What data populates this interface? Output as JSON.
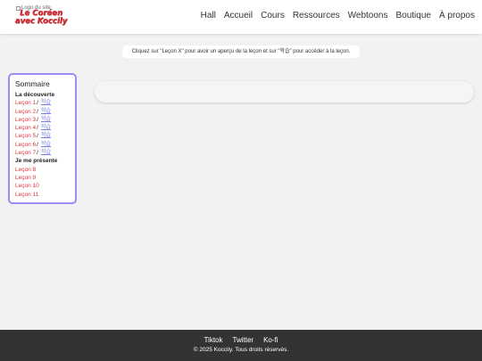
{
  "header": {
    "logo_alt": "Logo du site",
    "logo_text_line1": "Le Coréen",
    "logo_text_line2": "avec Koccily",
    "nav": [
      "Hall",
      "Accueil",
      "Cours",
      "Ressources",
      "Webtoons",
      "Boutique",
      "À propos"
    ]
  },
  "info_text": "Cliquez sur \"Leçon X\" pour avoir un aperçu de la leçon et sur \"학습\" pour accéder à la leçon.",
  "sommaire": {
    "title": "Sommaire",
    "sections": [
      {
        "title": "La découverte",
        "lessons": [
          {
            "label": "Leçon 1",
            "slash": "/",
            "hanja": "학습"
          },
          {
            "label": "Leçon 2",
            "slash": "/",
            "hanja": "학습"
          },
          {
            "label": "Leçon 3",
            "slash": "/",
            "hanja": "학습"
          },
          {
            "label": "Leçon 4",
            "slash": "/",
            "hanja": "학습"
          },
          {
            "label": "Leçon 5",
            "slash": "/",
            "hanja": "학습"
          },
          {
            "label": "Leçon 6",
            "slash": "/",
            "hanja": "학습"
          },
          {
            "label": "Leçon 7",
            "slash": "/",
            "hanja": "학습"
          }
        ]
      },
      {
        "title": "Je me présente",
        "lessons": [
          {
            "label": "Leçon 8"
          },
          {
            "label": "Leçon 9"
          },
          {
            "label": "Leçon 10"
          },
          {
            "label": "Leçon 11"
          }
        ]
      }
    ]
  },
  "footer": {
    "links": [
      "Tiktok",
      "Twitter",
      "Ko-fi"
    ],
    "copyright": "© 2025 Koccily. Tous droits réservés."
  }
}
